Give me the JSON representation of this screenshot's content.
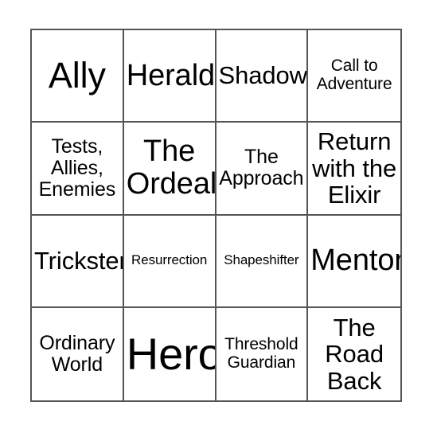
{
  "card": {
    "type": "bingo-card",
    "rows": 4,
    "columns": 4,
    "background_color": "#ffffff",
    "border_color": "#555555",
    "text_color": "#000000",
    "cells": [
      {
        "text": "Ally",
        "size": "sz-xl"
      },
      {
        "text": "Herald",
        "size": "sz-lg"
      },
      {
        "text": "Shadow",
        "size": "sz-md"
      },
      {
        "text": "Call to\nAdventure",
        "size": "sz-xs"
      },
      {
        "text": "Tests,\nAllies,\nEnemies",
        "size": "sz-sm"
      },
      {
        "text": "The\nOrdeal",
        "size": "sz-lg"
      },
      {
        "text": "The\nApproach",
        "size": "sz-sm"
      },
      {
        "text": "Return\nwith the\nElixir",
        "size": "sz-md"
      },
      {
        "text": "Trickster",
        "size": "sz-md"
      },
      {
        "text": "Resurrection",
        "size": "sz-xxs"
      },
      {
        "text": "Shapeshifter",
        "size": "sz-xxs"
      },
      {
        "text": "Mentor",
        "size": "sz-lg"
      },
      {
        "text": "Ordinary\nWorld",
        "size": "sz-sm"
      },
      {
        "text": "Hero",
        "size": "sz-xxl"
      },
      {
        "text": "Threshold\nGuardian",
        "size": "sz-xs"
      },
      {
        "text": "The\nRoad\nBack",
        "size": "sz-md"
      }
    ]
  }
}
